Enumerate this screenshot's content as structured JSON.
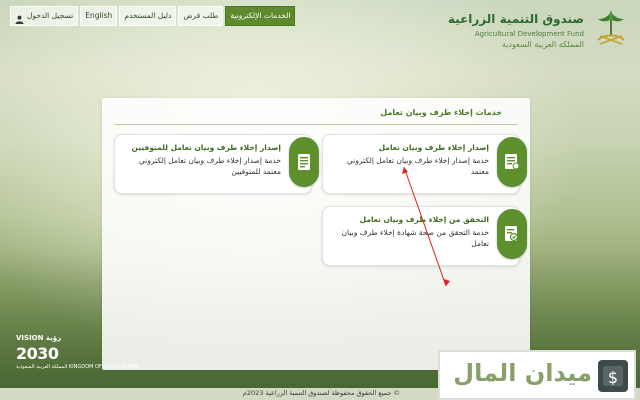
{
  "header": {
    "logo": {
      "name_ar": "صندوق التنمية الزراعية",
      "name_en": "Agricultural Development Fund",
      "kingdom_ar": "المملكة العربية السعودية"
    },
    "nav": [
      {
        "label": "الخدمات الإلكترونية",
        "active": true
      },
      {
        "label": "طلب قرض",
        "active": false
      },
      {
        "label": "دليل المستخدم",
        "active": false
      },
      {
        "label": "English",
        "active": false
      },
      {
        "label": "تسجيل الدخول",
        "active": false,
        "icon": "user-icon"
      }
    ]
  },
  "panel": {
    "title": "خدمات إخلاء طرف وبيان تعامل",
    "cards": [
      {
        "title": "إصدار إخلاء طرف وبيان تعامل",
        "desc": "خدمة إصدار إخلاء طرف وبيان تعامل إلكتروني معتمد",
        "icon": "document-list-icon"
      },
      {
        "title": "إصدار إخلاء طرف وبيان تعامل للمتوفيين",
        "desc": "خدمة إصدار إخلاء طرف وبيان تعامل إلكتروني معتمد للمتوفيين",
        "icon": "document-icon"
      },
      {
        "title": "التحقق من إخلاء طرف وبيان تعامل",
        "desc": "خدمة التحقق من صحة شهادة إخلاء طرف وبيان تعامل",
        "icon": "verify-document-icon"
      }
    ]
  },
  "vision": {
    "label": "VISION رؤية",
    "year": "2030",
    "sub": "المملكة العربية السعودية KINGDOM OF SAUDI ARABIA"
  },
  "footer": {
    "copyright": "© جميع الحقوق محفوظة لصندوق التنمية الزراعية 2023م"
  },
  "watermark": {
    "text": "ميدان المال"
  },
  "colors": {
    "accent": "#5e8f2d",
    "annotation_arrow": "#e02020"
  }
}
